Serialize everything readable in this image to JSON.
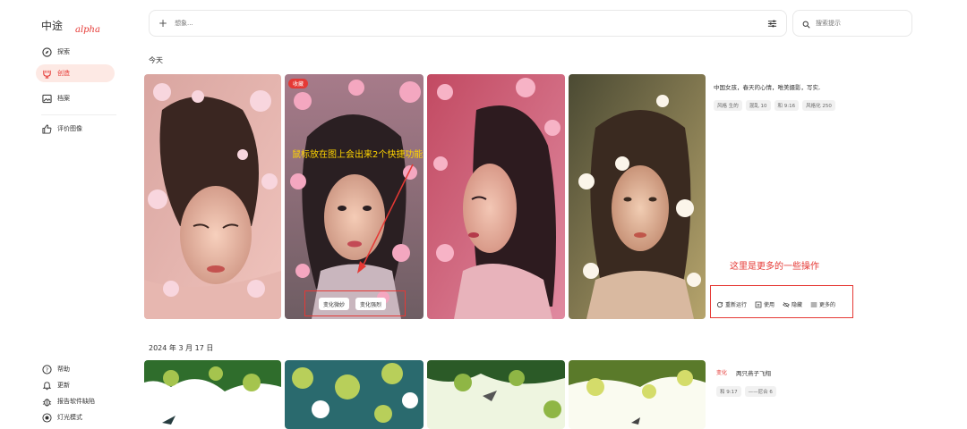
{
  "sidebar": {
    "brand": "中途",
    "alpha": "alpha",
    "items": [
      {
        "label": "探索"
      },
      {
        "label": "创造"
      },
      {
        "label": "档案"
      },
      {
        "label": "评价图像"
      }
    ],
    "bottom": [
      {
        "label": "帮助"
      },
      {
        "label": "更新"
      },
      {
        "label": "报告软件缺陷"
      },
      {
        "label": "灯光模式"
      }
    ]
  },
  "topbar": {
    "plus": "+",
    "placeholder": "想象...",
    "search_placeholder": "搜索提示"
  },
  "sections": [
    {
      "date": "今天",
      "prompt": "中国女孩，春天的心情，唯美摄影，写实,",
      "tags": [
        "风格 生的",
        "混乱 10",
        "和 9:16",
        "风格化 250"
      ],
      "fav_badge": "收藏",
      "quick_buttons": [
        "变化微妙",
        "变化强烈"
      ],
      "actions": [
        "重新运行",
        "使用",
        "隐藏",
        "更多的"
      ]
    },
    {
      "date": "2024 年 3 月 17 日",
      "variant": "变化",
      "prompt": "两只燕子飞翔",
      "tags": [
        "和 9:17",
        "——尼合 6"
      ]
    }
  ],
  "annotations": {
    "quick": "鼠标放在图上会出来2个快捷功能",
    "more": "这里是更多的一些操作"
  },
  "colors": {
    "accent": "#e53935",
    "annotation_yellow": "#ffd400",
    "annotation_red": "#e53935"
  }
}
